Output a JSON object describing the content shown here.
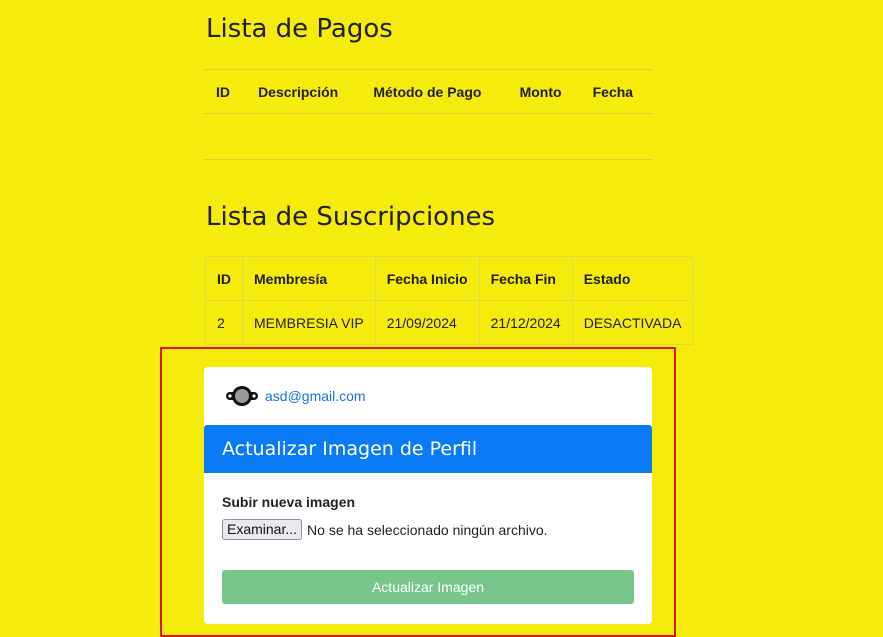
{
  "payments": {
    "title": "Lista de Pagos",
    "columns": [
      "ID",
      "Descripción",
      "Método de Pago",
      "Monto",
      "Fecha"
    ],
    "rows": []
  },
  "subscriptions": {
    "title": "Lista de Suscripciones",
    "columns": [
      "ID",
      "Membresía",
      "Fecha Inicio",
      "Fecha Fin",
      "Estado"
    ],
    "rows": [
      [
        "2",
        "MEMBRESIA VIP",
        "21/09/2024",
        "21/12/2024",
        "DESACTIVADA"
      ]
    ]
  },
  "profile": {
    "email": "asd@gmail.com",
    "avatar_icon": "user-avatar-icon"
  },
  "update_image": {
    "header": "Actualizar Imagen de Perfil",
    "upload_label": "Subir nueva imagen",
    "browse_button": "Examinar...",
    "file_status": "No se ha seleccionado ningún archivo.",
    "submit_button": "Actualizar Imagen"
  },
  "colors": {
    "page_background": "#f5eb0c",
    "card_header": "#0a7bf5",
    "submit_button": "#78c68b",
    "highlight_border": "#e01515",
    "link": "#1a73d8"
  }
}
